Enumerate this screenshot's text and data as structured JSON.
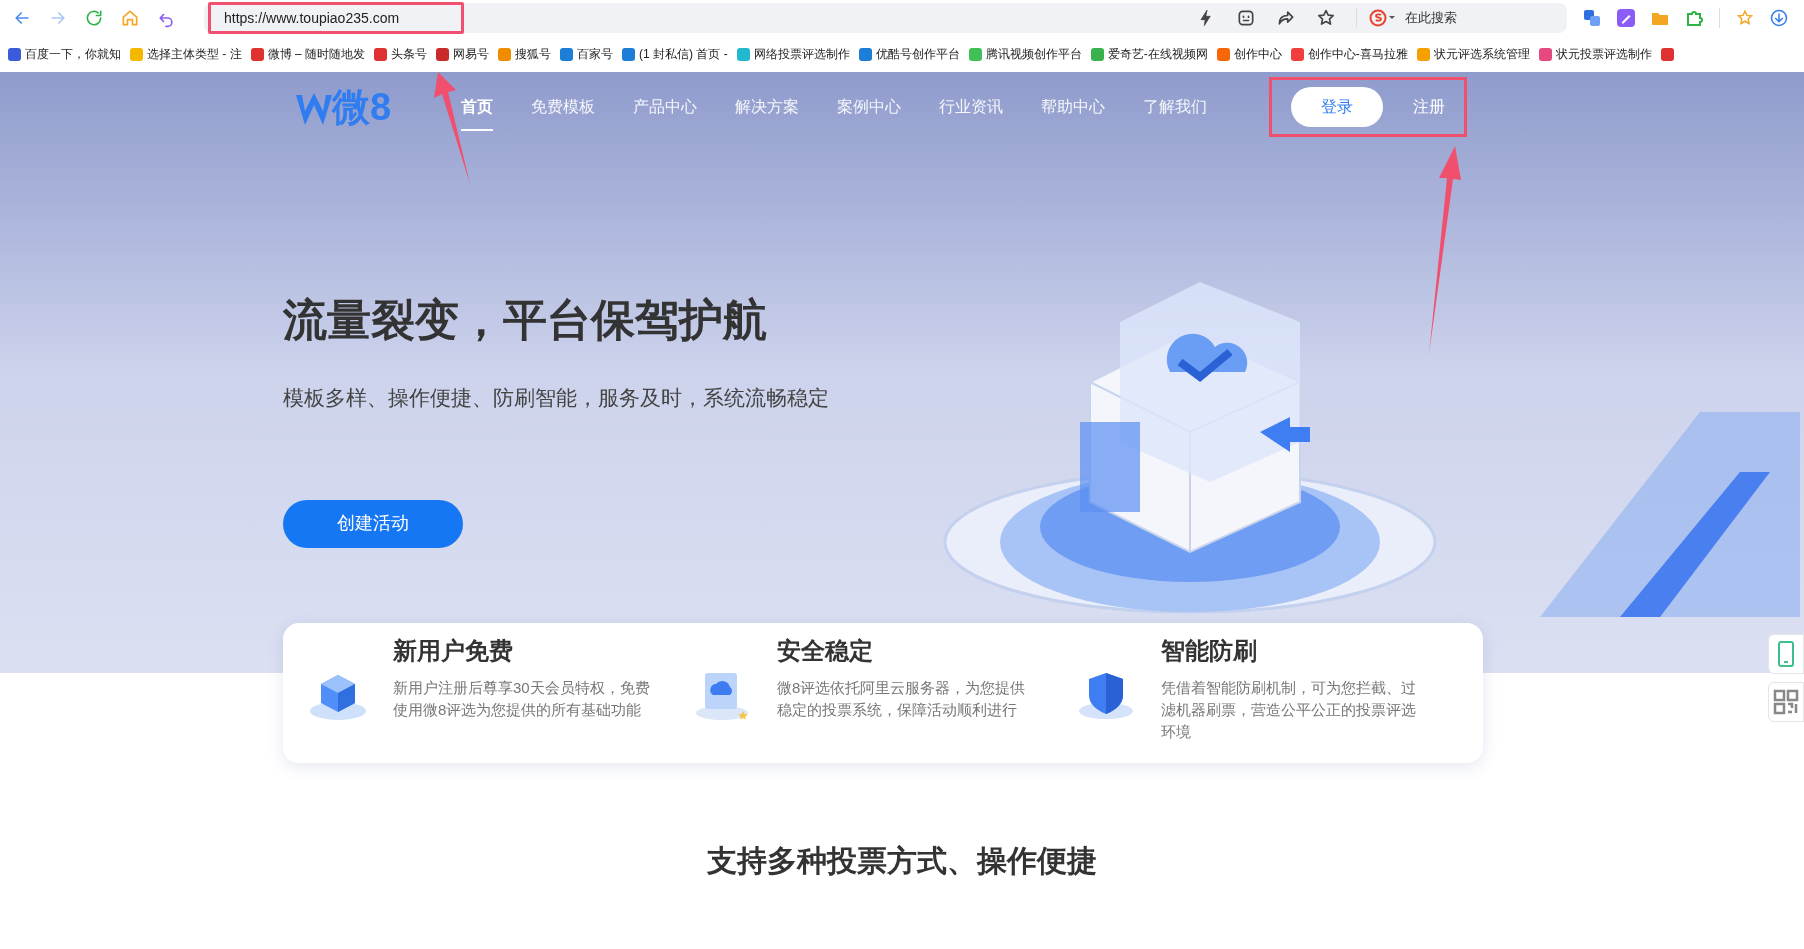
{
  "browser": {
    "url": "https://www.toupiao235.com",
    "search_placeholder": "在此搜索"
  },
  "bookmarks": [
    {
      "label": "百度一下，你就知"
    },
    {
      "label": "选择主体类型 - 注"
    },
    {
      "label": "微博 – 随时随地发"
    },
    {
      "label": "头条号"
    },
    {
      "label": "网易号"
    },
    {
      "label": "搜狐号"
    },
    {
      "label": "百家号"
    },
    {
      "label": "(1 封私信) 首页 -"
    },
    {
      "label": "网络投票评选制作"
    },
    {
      "label": "优酷号创作平台"
    },
    {
      "label": "腾讯视频创作平台"
    },
    {
      "label": "爱奇艺-在线视频网"
    },
    {
      "label": "创作中心"
    },
    {
      "label": "创作中心-喜马拉雅"
    },
    {
      "label": "状元评选系统管理"
    },
    {
      "label": "状元投票评选制作"
    }
  ],
  "site": {
    "logo_text": "微8",
    "nav": [
      {
        "label": "首页",
        "selected": true
      },
      {
        "label": "免费模板",
        "selected": false
      },
      {
        "label": "产品中心",
        "selected": false
      },
      {
        "label": "解决方案",
        "selected": false
      },
      {
        "label": "案例中心",
        "selected": false
      },
      {
        "label": "行业资讯",
        "selected": false
      },
      {
        "label": "帮助中心",
        "selected": false
      },
      {
        "label": "了解我们",
        "selected": false
      }
    ],
    "login": "登录",
    "register": "注册"
  },
  "hero": {
    "title": "流量裂变，平台保驾护航",
    "subtitle": "模板多样、操作便捷、防刷智能，服务及时，系统流畅稳定",
    "cta": "创建活动"
  },
  "features": [
    {
      "title": "新用户免费",
      "description": "新用户注册后尊享30天会员特权，免费使用微8评选为您提供的所有基础功能"
    },
    {
      "title": "安全稳定",
      "description": "微8评选依托阿里云服务器，为您提供稳定的投票系统，保障活动顺利进行"
    },
    {
      "title": "智能防刷",
      "description": "凭借着智能防刷机制，可为您拦截、过滤机器刷票，营造公平公正的投票评选环境"
    }
  ],
  "section_heading": "支持多种投票方式、操作便捷"
}
